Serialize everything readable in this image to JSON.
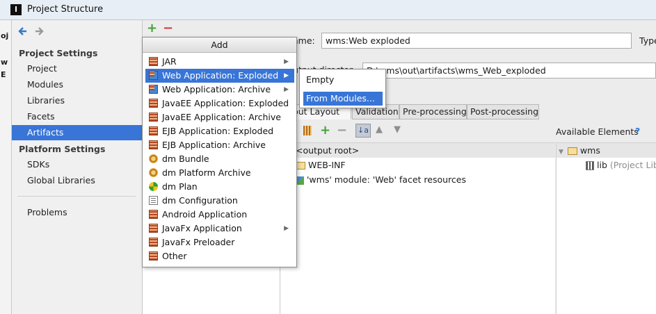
{
  "window": {
    "title": "Project Structure"
  },
  "edge": {
    "items": [
      "oj",
      "w",
      "E"
    ]
  },
  "sidebar": {
    "settings_header": "Project Settings",
    "settings_items": [
      "Project",
      "Modules",
      "Libraries",
      "Facets",
      "Artifacts"
    ],
    "platform_header": "Platform Settings",
    "platform_items": [
      "SDKs",
      "Global Libraries"
    ],
    "problems": "Problems",
    "selected": "Artifacts"
  },
  "toolbar": {
    "add": "+",
    "remove": "−"
  },
  "add_menu": {
    "title": "Add",
    "items": [
      {
        "label": "JAR",
        "icon": "jar-icon",
        "submenu": true
      },
      {
        "label": "Web Application: Exploded",
        "icon": "web-app-icon",
        "submenu": true,
        "selected": true
      },
      {
        "label": "Web Application: Archive",
        "icon": "web-app-icon",
        "submenu": true
      },
      {
        "label": "JavaEE Application: Exploded",
        "icon": "jar-icon"
      },
      {
        "label": "JavaEE Application: Archive",
        "icon": "jar-icon"
      },
      {
        "label": "EJB Application: Exploded",
        "icon": "jar-icon"
      },
      {
        "label": "EJB Application: Archive",
        "icon": "jar-icon"
      },
      {
        "label": "dm Bundle",
        "icon": "bundle-icon"
      },
      {
        "label": "dm Platform Archive",
        "icon": "bundle-icon"
      },
      {
        "label": "dm Plan",
        "icon": "plan-icon"
      },
      {
        "label": "dm Configuration",
        "icon": "config-icon"
      },
      {
        "label": "Android Application",
        "icon": "jar-icon"
      },
      {
        "label": "JavaFx Application",
        "icon": "jar-icon",
        "submenu": true
      },
      {
        "label": "JavaFx Preloader",
        "icon": "jar-icon"
      },
      {
        "label": "Other",
        "icon": "jar-icon"
      }
    ]
  },
  "submenu": {
    "items": [
      {
        "label": "Empty"
      },
      {
        "label": "From Modules...",
        "selected": true
      }
    ]
  },
  "form": {
    "name_label": "ame:",
    "name_value": "wms:Web exploded",
    "type_label": "Type",
    "output_label": "utput director",
    "output_value": "D:\\wms\\out\\artifacts\\wms_Web_exploded"
  },
  "tabs": [
    "utput Layout",
    "Validation",
    "Pre-processing",
    "Post-processing"
  ],
  "layout": {
    "available_label": "Available Elements",
    "help": "?",
    "sort_label": "↓a",
    "up": "▲",
    "down": "▼",
    "output_root": "<output root>",
    "tree": [
      "WEB-INF",
      "'wms' module: 'Web' facet resources"
    ],
    "available_tree": {
      "root": "wms",
      "lib": "lib",
      "lib_suffix": "(Project Lib"
    }
  },
  "colors": {
    "selection": "#3875d7",
    "add_green": "#3fa235",
    "remove_red": "#cf3c3c"
  }
}
